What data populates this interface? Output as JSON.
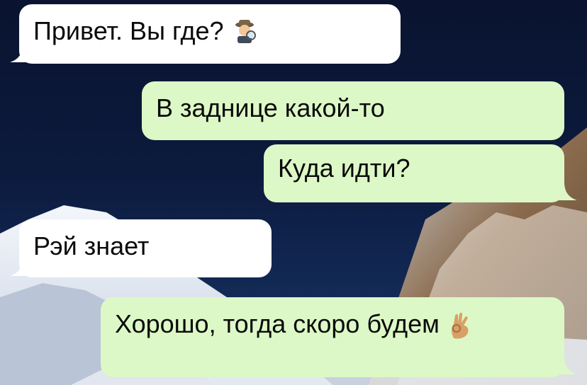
{
  "chat": {
    "messages": [
      {
        "id": "m1",
        "direction": "incoming",
        "text": "Привет. Вы где?",
        "emoji_icon": "detective-emoji"
      },
      {
        "id": "m2",
        "direction": "outgoing",
        "text": "В заднице какой-то"
      },
      {
        "id": "m3",
        "direction": "outgoing",
        "text": "Куда идти?"
      },
      {
        "id": "m4",
        "direction": "incoming",
        "text": "Рэй знает"
      },
      {
        "id": "m5",
        "direction": "outgoing",
        "text": "Хорошо, тогда скоро будем",
        "emoji_icon": "ok-hand-emoji"
      }
    ]
  },
  "colors": {
    "incoming_bubble": "#ffffff",
    "outgoing_bubble": "#dcf8c6",
    "wallpaper": "#0c1a3d"
  }
}
